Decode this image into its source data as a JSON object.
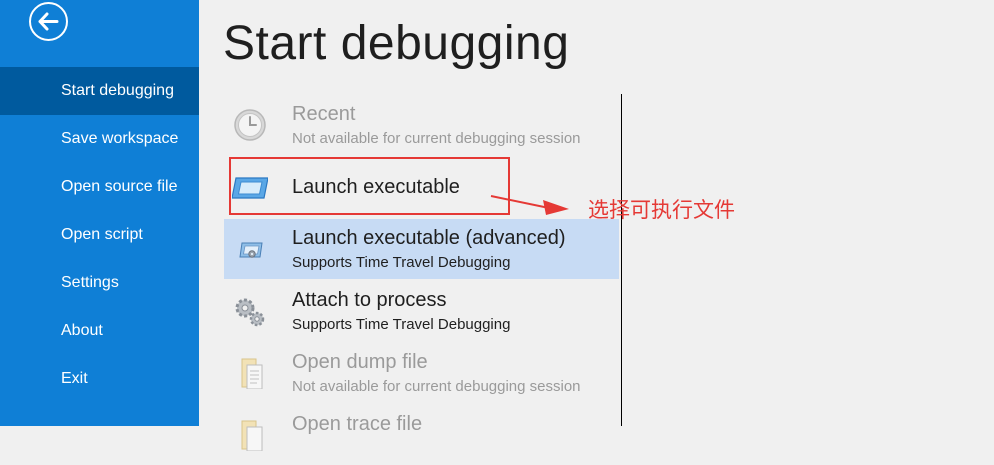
{
  "sidebar": {
    "back_icon": "back-arrow-icon",
    "items": [
      {
        "label": "Start debugging",
        "active": true
      },
      {
        "label": "Save workspace",
        "active": false
      },
      {
        "label": "Open source file",
        "active": false
      },
      {
        "label": "Open script",
        "active": false
      },
      {
        "label": "Settings",
        "active": false
      },
      {
        "label": "About",
        "active": false
      },
      {
        "label": "Exit",
        "active": false
      }
    ]
  },
  "main": {
    "title": "Start debugging",
    "options": [
      {
        "title": "Recent",
        "subtitle": "Not available for current debugging session",
        "icon": "clock-icon",
        "disabled": true
      },
      {
        "title": "Launch executable",
        "subtitle": "",
        "icon": "window-frame-icon",
        "disabled": false
      },
      {
        "title": "Launch executable (advanced)",
        "subtitle": "Supports Time Travel Debugging",
        "icon": "window-gear-icon",
        "disabled": false,
        "selected": true
      },
      {
        "title": "Attach to process",
        "subtitle": "Supports Time Travel Debugging",
        "icon": "gears-icon",
        "disabled": false
      },
      {
        "title": "Open dump file",
        "subtitle": "Not available for current debugging session",
        "icon": "document-icon",
        "disabled": true
      },
      {
        "title": "Open trace file",
        "subtitle": "",
        "icon": "document-icon",
        "disabled": true
      }
    ]
  },
  "annotation": {
    "text": "选择可执行文件",
    "color": "#e53935"
  },
  "colors": {
    "sidebar_bg": "#0f7fd6",
    "sidebar_active": "#005a9e",
    "selected_row": "#c7dbf4",
    "content_bg": "#f0f0f0"
  }
}
